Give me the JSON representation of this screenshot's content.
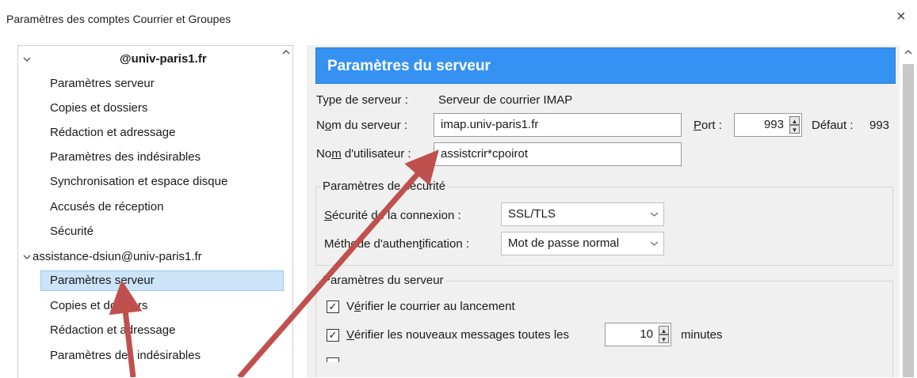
{
  "window": {
    "title": "Paramètres des comptes Courrier et Groupes",
    "close_glyph": "×"
  },
  "tree": {
    "account1": {
      "name": "@univ-paris1.fr",
      "expanded_glyph": "v"
    },
    "account1_items": [
      "Paramètres serveur",
      "Copies et dossiers",
      "Rédaction et adressage",
      "Paramètres des indésirables",
      "Synchronisation et espace disque",
      "Accusés de réception",
      "Sécurité"
    ],
    "account2": {
      "name": "assistance-dsiun@univ-paris1.fr",
      "expanded_glyph": "v"
    },
    "account2_items": [
      "Paramètres serveur",
      "Copies et dossiers",
      "Rédaction et adressage",
      "Paramètres des indésirables"
    ]
  },
  "server": {
    "header": "Paramètres du serveur",
    "type_label": "Type de serveur :",
    "type_value": "Serveur de courrier IMAP",
    "name_label_pre": "N",
    "name_label_u": "o",
    "name_label_post": "m du serveur :",
    "name_value": "imap.univ-paris1.fr",
    "port_label_u": "P",
    "port_label_post": "ort :",
    "port_value": "993",
    "default_label": "Défaut :",
    "default_value": "993",
    "user_label_pre": "No",
    "user_label_u": "m",
    "user_label_post": " d'utilisateur :",
    "user_value": "assistcrir*cpoirot"
  },
  "security": {
    "legend": "Paramètres de sécurité",
    "conn_label_u": "S",
    "conn_label_post": "écurité de la connexion :",
    "conn_value": "SSL/TLS",
    "auth_label_pre": "Méthode d'authen",
    "auth_label_u": "t",
    "auth_label_post": "ification :",
    "auth_value": "Mot de passe normal"
  },
  "server_settings": {
    "legend": "Paramètres du serveur",
    "check1_pre": "V",
    "check1_u": "é",
    "check1_post": "rifier le courrier au lancement",
    "check2_u": "V",
    "check2_post": "érifier les nouveaux messages toutes les",
    "interval_value": "10",
    "interval_unit": "minutes",
    "checkmark": "✓"
  },
  "annotation_color": "#c0504d"
}
